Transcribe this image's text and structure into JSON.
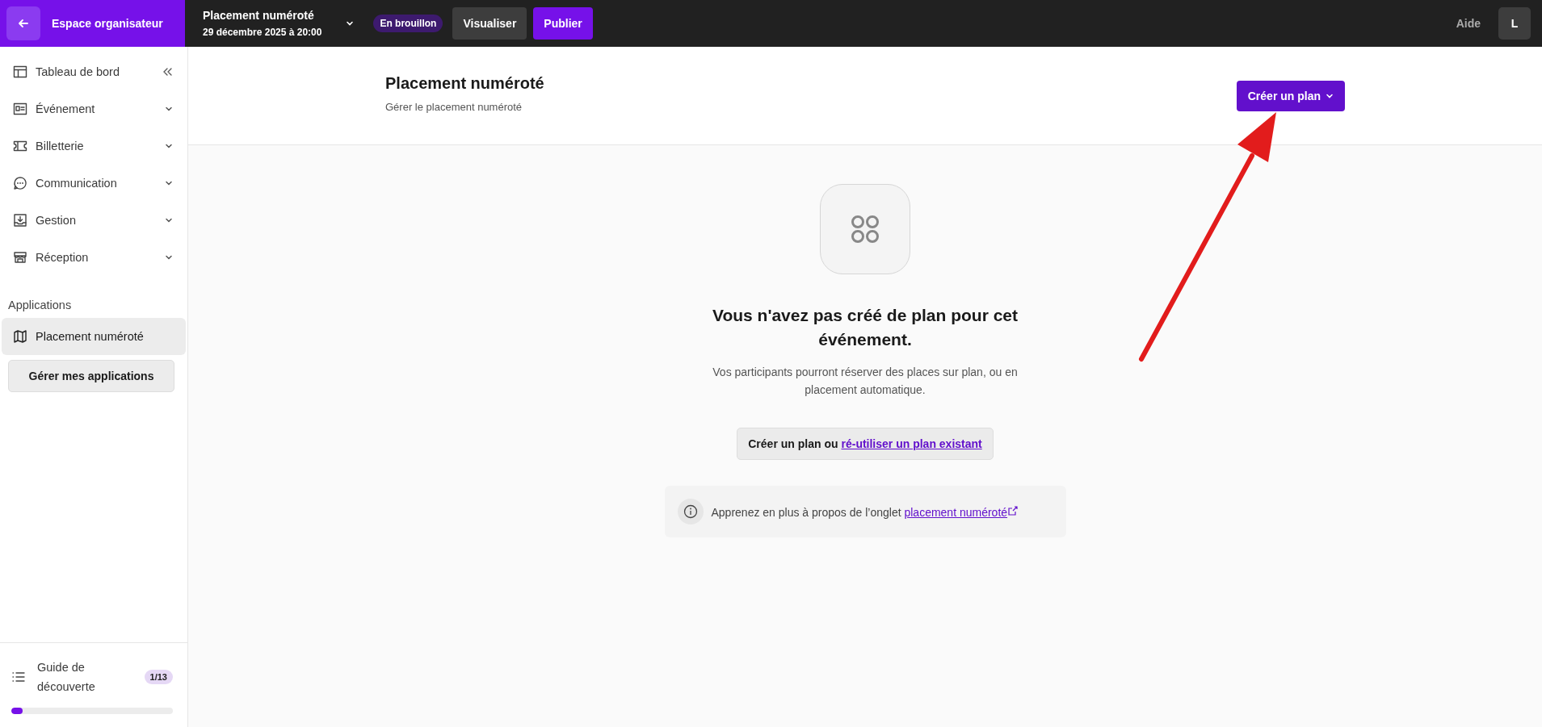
{
  "topbar": {
    "back_label": "Espace organisateur",
    "event": {
      "title": "Placement numéroté",
      "date": "29 décembre 2025 à 20:00"
    },
    "status_badge": "En brouillon",
    "buttons": [
      {
        "label": "Visualiser",
        "kind": "secondary"
      },
      {
        "label": "Publier",
        "kind": "primary"
      }
    ],
    "help": "Aide",
    "avatar": "L"
  },
  "sidebar": {
    "items": [
      {
        "label": "Tableau de bord",
        "kind": "collapse",
        "selected": false
      },
      {
        "label": "Événement",
        "kind": "expand",
        "selected": false
      },
      {
        "label": "Billetterie",
        "kind": "expand",
        "selected": false
      },
      {
        "label": "Communication",
        "kind": "expand",
        "selected": false
      },
      {
        "label": "Gestion",
        "kind": "expand",
        "selected": false
      },
      {
        "label": "Réception",
        "kind": "expand",
        "selected": false
      }
    ],
    "applications": {
      "heading": "Applications",
      "items": [
        {
          "label": "Placement numéroté",
          "selected": true
        }
      ],
      "manage_button": "Gérer mes applications"
    },
    "guide": {
      "label": "Guide de découverte",
      "count": "1/13",
      "level": 0.07
    }
  },
  "page_header": {
    "title": "Placement numéroté",
    "subtitle": "Gérer le placement numéroté",
    "create_button": "Créer un plan"
  },
  "empty_state": {
    "heading": "Vous n'avez pas créé de plan pour cet événement.",
    "text": "Vos participants pourront réserver des places sur plan, ou en placement automatique.",
    "action": {
      "button": "Créer un plan ou",
      "link": "ré-utiliser un plan existant"
    },
    "info": {
      "text": "Apprenez en plus à propos de l’onglet ",
      "link": "placement numéroté"
    }
  },
  "annotation": {
    "kind": "arrow"
  }
}
